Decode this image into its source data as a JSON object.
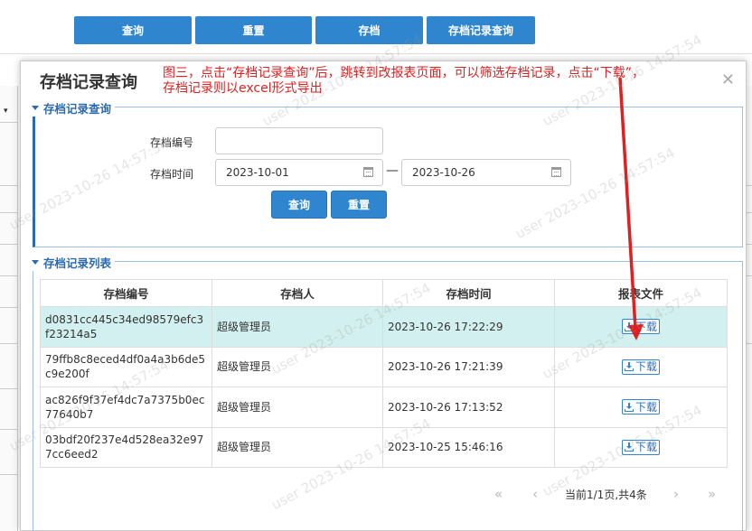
{
  "background": {
    "top_buttons": [
      "查询",
      "重置",
      "存档",
      "存档记录查询"
    ]
  },
  "modal": {
    "title": "存档记录查询",
    "close_glyph": "✕",
    "annotation_line1": "图三，点击“存档记录查询”后，跳转到改报表页面，可以筛选存档记录，点击“下载”，",
    "annotation_line2": "存档记录则以excel形式导出",
    "search_panel": {
      "legend": "存档记录查询",
      "archive_no_label": "存档编号",
      "archive_no_value": "",
      "archive_time_label": "存档时间",
      "start_date": "2023-10-01",
      "end_date": "2023-10-26",
      "range_separator": "—",
      "query_button": "查询",
      "reset_button": "重置"
    },
    "list_panel": {
      "legend": "存档记录列表",
      "columns": [
        "存档编号",
        "存档人",
        "存档时间",
        "报表文件"
      ],
      "rows": [
        {
          "id": "d0831cc445c34ed98579efc3f23214a5",
          "user": "超级管理员",
          "time": "2023-10-26 17:22:29",
          "action": "下载",
          "selected": true
        },
        {
          "id": "79ffb8c8eced4df0a4a3b6de5c9e200f",
          "user": "超级管理员",
          "time": "2023-10-26 17:21:39",
          "action": "下载",
          "selected": false
        },
        {
          "id": "ac826f9f37ef4dc7a7375b0ec77640b7",
          "user": "超级管理员",
          "time": "2023-10-26 17:13:52",
          "action": "下载",
          "selected": false
        },
        {
          "id": "03bdf20f237e4d528ea32e977cc6eed2",
          "user": "超级管理员",
          "time": "2023-10-25 15:46:16",
          "action": "下载",
          "selected": false
        }
      ],
      "pager": {
        "first": "«",
        "prev": "‹",
        "info": "当前1/1页,共4条",
        "next": "›",
        "last": "»"
      }
    }
  },
  "watermark_text": "user 2023-10-26 14:57:54",
  "colors": {
    "primary": "#2f86cf",
    "legend_blue": "#2a6ab1",
    "selected_row": "#d2f0ef",
    "annotation_red": "#e02020"
  }
}
